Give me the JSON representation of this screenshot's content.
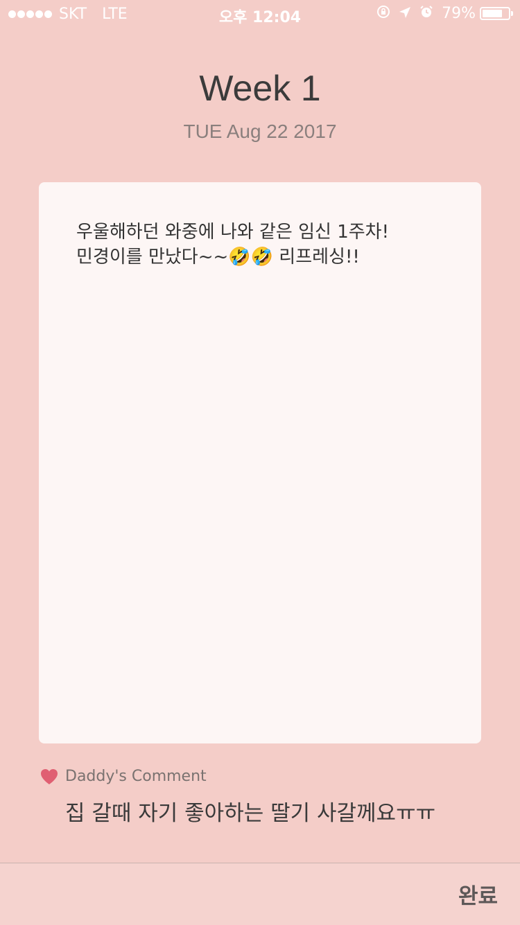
{
  "status_bar": {
    "carrier": "SKT",
    "network": "LTE",
    "time": "오후 12:04",
    "battery_percent": "79%",
    "battery_level": 0.79,
    "icons": [
      "rotation-lock-icon",
      "location-arrow-icon",
      "alarm-icon"
    ]
  },
  "header": {
    "title": "Week 1",
    "date": "TUE Aug 22 2017"
  },
  "diary": {
    "line1": "우울해하던 와중에 나와 같은 임신 1주차!",
    "line2": "민경이를 만났다~~🤣🤣 리프레싱!!"
  },
  "comment": {
    "label": "Daddy's Comment",
    "text": "집 갈때 자기 좋아하는 딸기 사갈께요ㅠㅠ",
    "icon": "heart-icon",
    "icon_color": "#e05f72"
  },
  "footer": {
    "done_label": "완료"
  },
  "colors": {
    "background": "#f4cdc8",
    "card": "#fdf6f5"
  }
}
